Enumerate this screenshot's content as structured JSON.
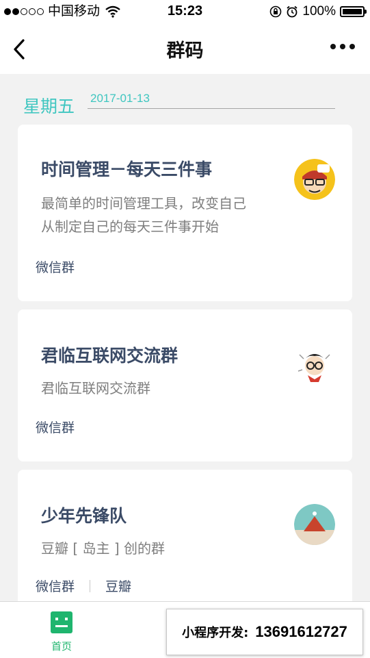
{
  "status_bar": {
    "carrier": "中国移动",
    "time": "15:23",
    "battery": "100%",
    "battery_level": 1.0
  },
  "nav": {
    "title": "群码",
    "back_icon": "chevron-left-icon",
    "more_icon": "ellipsis-icon"
  },
  "date_header": {
    "weekday": "星期五",
    "date": "2017-01-13"
  },
  "cards": [
    {
      "title": "时间管理－每天三件事",
      "description_lines": [
        "最简单的时间管理工具，改变自己",
        "从制定自己的每天三件事开始"
      ],
      "tags": [
        "微信群"
      ]
    },
    {
      "title": "君临互联网交流群",
      "description_lines": [
        "君临互联网交流群"
      ],
      "tags": [
        "微信群"
      ]
    },
    {
      "title": "少年先锋队",
      "description_lines": [
        "豆瓣 [ 岛主 ] 创的群"
      ],
      "tags": [
        "微信群",
        "豆瓣"
      ]
    }
  ],
  "tab_bar": {
    "home_label": "首页",
    "home_icon": "home-grid-icon"
  },
  "promo": {
    "label": "小程序开发:",
    "phone": "13691612727"
  },
  "colors": {
    "accent_teal": "#3fc6c0",
    "title_navy": "#3a4a66",
    "tab_green": "#1fb56e",
    "background": "#f2f2f2"
  }
}
